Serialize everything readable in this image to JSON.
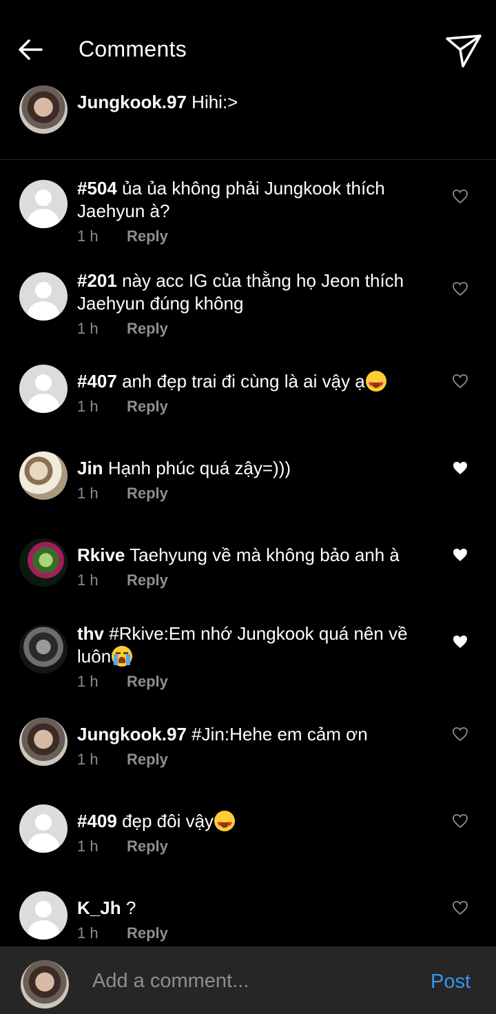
{
  "header": {
    "title": "Comments"
  },
  "caption": {
    "username": "Jungkook.97",
    "text": "Hihi:>"
  },
  "comments": [
    {
      "username": "#504",
      "text": "ủa ủa không phải Jungkook thích Jaehyun à?",
      "time": "1 h",
      "reply": "Reply",
      "liked": false
    },
    {
      "username": "#201",
      "text": "này acc IG của thằng họ Jeon thích Jaehyun đúng không",
      "time": "1 h",
      "reply": "Reply",
      "liked": false
    },
    {
      "username": "#407",
      "text": "anh đẹp trai đi cùng là ai vậy ạ",
      "emoji": "heart-eyes-emoji",
      "time": "1 h",
      "reply": "Reply",
      "liked": false
    },
    {
      "username": "Jin",
      "text": "Hạnh phúc quá zậy=)))",
      "time": "1 h",
      "reply": "Reply",
      "liked": true
    },
    {
      "username": "Rkive",
      "text": "Taehyung về mà không bảo anh à",
      "time": "1 h",
      "reply": "Reply",
      "liked": true
    },
    {
      "username": "thv",
      "text": "#Rkive:Em nhớ Jungkook quá nên về luôn",
      "emoji": "loudly-crying-emoji",
      "time": "1 h",
      "reply": "Reply",
      "liked": true
    },
    {
      "username": "Jungkook.97",
      "text": "#Jin:Hehe em cảm ơn",
      "time": "1 h",
      "reply": "Reply",
      "liked": false
    },
    {
      "username": "#409",
      "text": "đẹp đôi vậy",
      "emoji": "heart-eyes-emoji",
      "time": "1 h",
      "reply": "Reply",
      "liked": false
    },
    {
      "username": "K_Jh",
      "text": "?",
      "time": "1 h",
      "reply": "Reply",
      "liked": false
    }
  ],
  "footer": {
    "placeholder": "Add a comment...",
    "post_label": "Post"
  },
  "colors": {
    "background": "#000000",
    "footer_bg": "#262626",
    "muted_text": "#8e8e8e",
    "post_blue": "#3897f0"
  },
  "icons": {
    "back": "arrow-left-icon",
    "share": "paper-plane-icon",
    "like": "heart-icon"
  }
}
